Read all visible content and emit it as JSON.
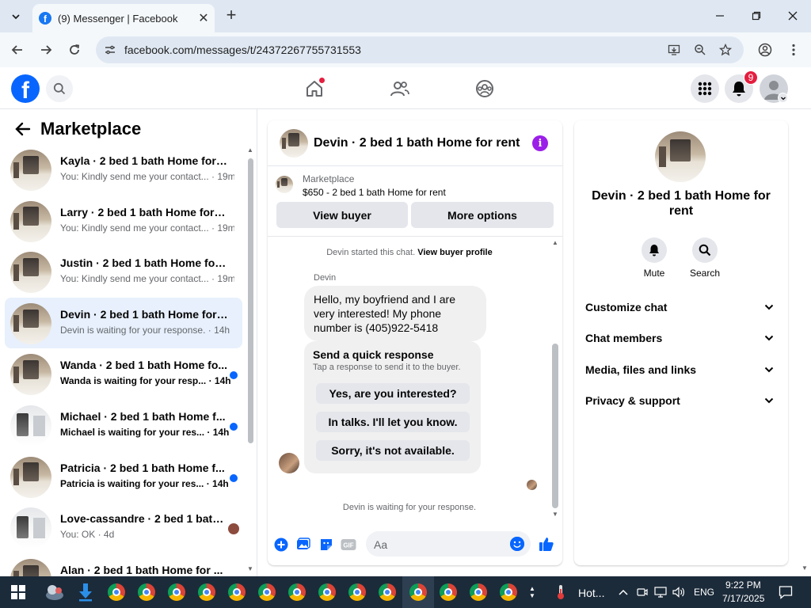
{
  "browser": {
    "tab_title": "(9) Messenger | Facebook",
    "url": "facebook.com/messages/t/24372267755731553"
  },
  "header": {
    "notifications_count": "9"
  },
  "left_panel": {
    "title": "Marketplace",
    "conversations": [
      {
        "name": "Kayla · 2 bed 1 bath Home for re...",
        "preview": "You: Kindly send me your contact... · 19m",
        "unread": false,
        "thumb": "house"
      },
      {
        "name": "Larry · 2 bed 1 bath Home for rent",
        "preview": "You: Kindly send me your contact... · 19m",
        "unread": false,
        "thumb": "house"
      },
      {
        "name": "Justin · 2 bed 1 bath Home for r...",
        "preview": "You: Kindly send me your contact... · 19m",
        "unread": false,
        "thumb": "house"
      },
      {
        "name": "Devin · 2 bed 1 bath Home for r...",
        "preview": "Devin is waiting for your response. · 14h",
        "unread": false,
        "active": true,
        "thumb": "house"
      },
      {
        "name": "Wanda · 2 bed 1 bath Home fo...",
        "preview": "Wanda is waiting for your resp... · 14h",
        "unread": true,
        "thumb": "house"
      },
      {
        "name": "Michael · 2 bed 1 bath Home f...",
        "preview": "Michael is waiting for your res... · 14h",
        "unread": true,
        "thumb": "white"
      },
      {
        "name": "Patricia · 2 bed 1 bath Home f...",
        "preview": "Patricia is waiting for your res... · 14h",
        "unread": true,
        "thumb": "house"
      },
      {
        "name": "Love-cassandre · 2 bed 1 bath...",
        "preview": "You: OK · 4d",
        "unread": false,
        "thumb": "white"
      },
      {
        "name": "Alan · 2 bed 1 bath Home for ...",
        "preview": "",
        "unread": false,
        "thumb": "house"
      }
    ]
  },
  "chat": {
    "title": "Devin · 2 bed 1 bath Home for rent",
    "marketplace_label": "Marketplace",
    "listing": "$650 - 2 bed 1 bath Home for rent",
    "view_buyer": "View buyer",
    "more_options": "More options",
    "started_text": "Devin started this chat.",
    "view_buyer_profile": "View buyer profile",
    "sender": "Devin",
    "message": "Hello, my boyfriend and I are very interested! My phone number is (405)922-5418",
    "quick_title": "Send a quick response",
    "quick_sub": "Tap a response to send it to the buyer.",
    "quick_responses": [
      "Yes, are you interested?",
      "In talks. I'll let you know.",
      "Sorry, it's not available."
    ],
    "waiting": "Devin is waiting for your response.",
    "composer_placeholder": "Aa"
  },
  "right_panel": {
    "name": "Devin · 2 bed 1 bath Home for rent",
    "mute": "Mute",
    "search": "Search",
    "sections": [
      "Customize chat",
      "Chat members",
      "Media, files and links",
      "Privacy & support"
    ]
  },
  "taskbar": {
    "weather": "Hot...",
    "lang": "ENG",
    "time": "9:22 PM",
    "date": "7/17/2025"
  },
  "colors": {
    "fb_blue": "#0866ff",
    "accent_purple": "#9b1fe8",
    "active_row": "#e7f0fc"
  }
}
